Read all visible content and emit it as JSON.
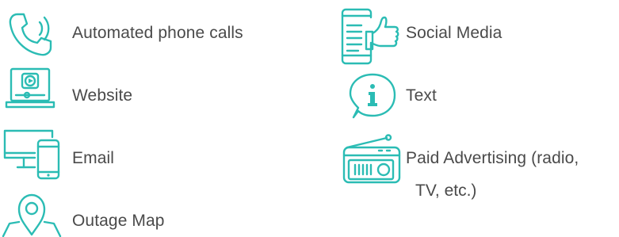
{
  "accent_color": "#2bbcb4",
  "text_color": "#4a4a4a",
  "left_column": [
    {
      "icon": "phone-icon",
      "label": "Automated phone calls"
    },
    {
      "icon": "website-icon",
      "label": "Website"
    },
    {
      "icon": "email-devices-icon",
      "label": "Email"
    },
    {
      "icon": "map-pin-icon",
      "label": "Outage Map"
    }
  ],
  "right_column": [
    {
      "icon": "social-media-icon",
      "label": "Social Media"
    },
    {
      "icon": "text-info-icon",
      "label": "Text"
    },
    {
      "icon": "radio-icon",
      "label": "Paid Advertising (radio,",
      "label_cont": "TV, etc.)"
    }
  ]
}
